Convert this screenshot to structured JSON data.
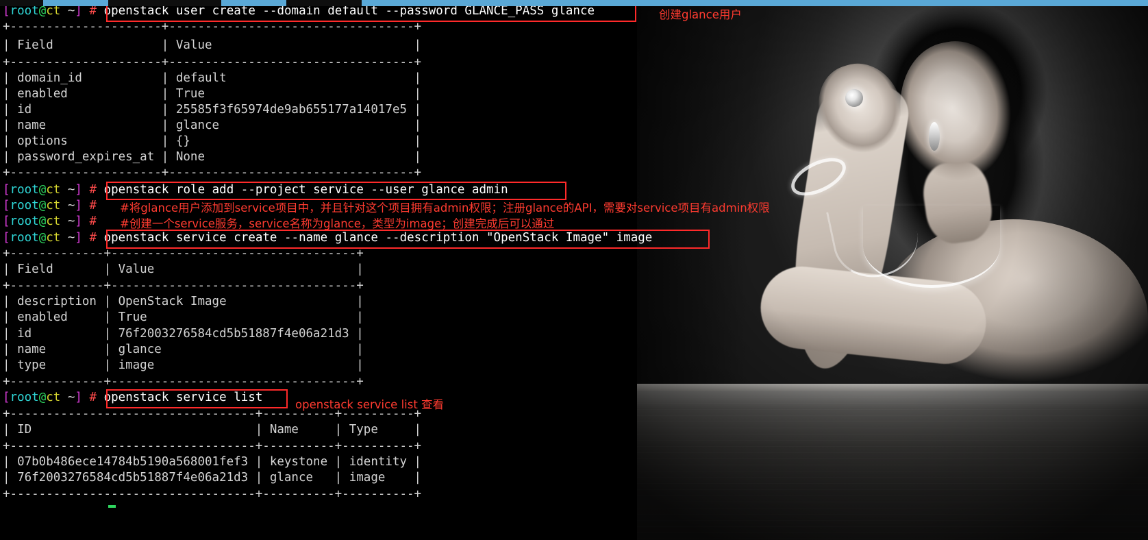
{
  "window": {
    "title": "root@ct:~ — OpenStack Glance service registration terminal",
    "topbar_color": "#5aa8d6",
    "terminal_bg": "#000000"
  },
  "prompt": {
    "open_bracket": "[",
    "user": "root",
    "at": "@",
    "host": "ct",
    "cwd": "~",
    "close_bracket": "]",
    "symbol": "#",
    "full": "[root@ct ~] #"
  },
  "annotations": {
    "create_user": "创建glance用户",
    "service_list": "openstack service list 查看",
    "comment_role": "#将glance用户添加到service项目中，并且针对这个项目拥有admin权限；注册glance的API，需要对service项目有admin权限",
    "comment_service": "#创建一个service服务，service名称为glance，类型为image；创建完成后可以通过"
  },
  "session": {
    "commands": {
      "user_create": "openstack user create --domain default --password GLANCE_PASS glance",
      "role_add": "openstack role add --project service --user glance admin",
      "service_create": "openstack service create --name glance --description \"OpenStack Image\" image",
      "service_list": "openstack service list"
    },
    "user_create_table": {
      "rule_top": "+---------------------+----------------------------------+",
      "header": "| Field               | Value                            |",
      "rule_mid": "+---------------------+----------------------------------+",
      "rows": [
        "| domain_id           | default                          |",
        "| enabled             | True                             |",
        "| id                  | 25585f3f65974de9ab655177a14017e5 |",
        "| name                | glance                           |",
        "| options             | {}                               |",
        "| password_expires_at | None                             |"
      ],
      "rule_bottom": "+---------------------+----------------------------------+",
      "fields": [
        {
          "field": "domain_id",
          "value": "default"
        },
        {
          "field": "enabled",
          "value": "True"
        },
        {
          "field": "id",
          "value": "25585f3f65974de9ab655177a14017e5"
        },
        {
          "field": "name",
          "value": "glance"
        },
        {
          "field": "options",
          "value": "{}"
        },
        {
          "field": "password_expires_at",
          "value": "None"
        }
      ]
    },
    "service_create_table": {
      "rule_top": "+-------------+----------------------------------+",
      "header": "| Field       | Value                            |",
      "rule_mid": "+-------------+----------------------------------+",
      "rows": [
        "| description | OpenStack Image                  |",
        "| enabled     | True                             |",
        "| id          | 76f2003276584cd5b51887f4e06a21d3 |",
        "| name        | glance                           |",
        "| type        | image                            |"
      ],
      "rule_bottom": "+-------------+----------------------------------+",
      "fields": [
        {
          "field": "description",
          "value": "OpenStack Image"
        },
        {
          "field": "enabled",
          "value": "True"
        },
        {
          "field": "id",
          "value": "76f2003276584cd5b51887f4e06a21d3"
        },
        {
          "field": "name",
          "value": "glance"
        },
        {
          "field": "type",
          "value": "image"
        }
      ]
    },
    "service_list_table": {
      "rule_top": "+----------------------------------+----------+----------+",
      "header": "| ID                               | Name     | Type     |",
      "rule_mid": "+----------------------------------+----------+----------+",
      "rows": [
        "| 07b0b486ece14784b5190a568001fef3 | keystone | identity |",
        "| 76f2003276584cd5b51887f4e06a21d3 | glance   | image    |"
      ],
      "rule_bottom": "+----------------------------------+----------+----------+",
      "columns": [
        "ID",
        "Name",
        "Type"
      ],
      "entries": [
        {
          "id": "07b0b486ece14784b5190a568001fef3",
          "name": "keystone",
          "type": "identity"
        },
        {
          "id": "76f2003276584cd5b51887f4e06a21d3",
          "name": "glance",
          "type": "image"
        }
      ]
    }
  },
  "colors": {
    "prompt_user": "#2fd7d7",
    "prompt_at": "#2fd75f",
    "prompt_host": "#d7d72f",
    "prompt_bracket": "#d93cd9",
    "prompt_hash": "#ff4b4b",
    "highlight_box": "#ff2a2a",
    "annotation_text": "#ff3b30",
    "output_text": "#d3d3d3"
  }
}
